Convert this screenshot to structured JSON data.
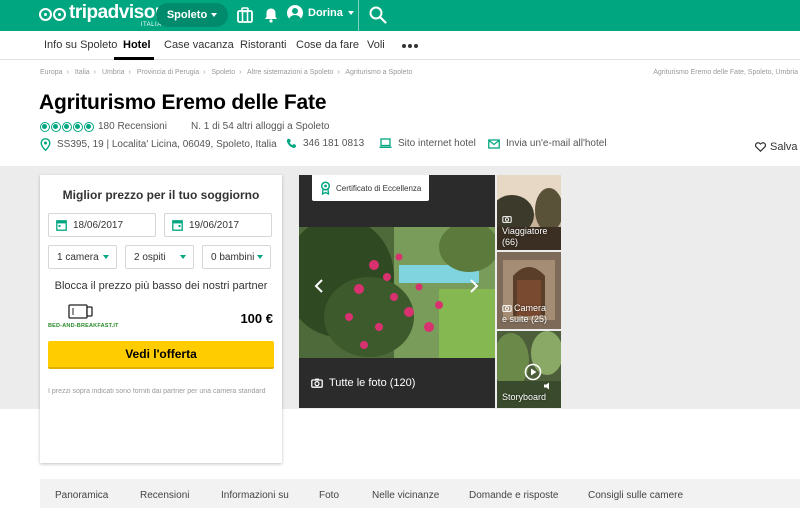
{
  "header": {
    "logo_word": "tripadvisor",
    "logo_sub": "ITALIA",
    "city": "Spoleto",
    "user": "Dorina"
  },
  "nav": {
    "items": [
      {
        "label": "Info su Spoleto"
      },
      {
        "label": "Hotel"
      },
      {
        "label": "Case vacanza"
      },
      {
        "label": "Ristoranti"
      },
      {
        "label": "Cose da fare"
      },
      {
        "label": "Voli"
      }
    ]
  },
  "breadcrumb": {
    "items": [
      "Europa",
      "Italia",
      "Umbria",
      "Provincia di Perugia",
      "Spoleto",
      "Altre sistemazioni a Spoleto",
      "Agriturismo a Spoleto"
    ],
    "right": "Agriturismo Eremo delle Fate, Spoleto, Umbria"
  },
  "hotel": {
    "name": "Agriturismo Eremo delle Fate",
    "rating": 5,
    "reviews": "180 Recensioni",
    "rank": "N. 1 di 54 altri alloggi a Spoleto",
    "address": "SS395, 19 | Localita' Licina, 06049, Spoleto, Italia",
    "phone": "346 181 0813",
    "website": "Sito internet hotel",
    "email": "Invia un'e-mail all'hotel",
    "save": "Salva"
  },
  "booking": {
    "title": "Miglior prezzo per il tuo soggiorno",
    "checkin": "18/06/2017",
    "checkout": "19/06/2017",
    "rooms": "1 camera",
    "guests": "2 ospiti",
    "children": "0 bambini",
    "partner_note": "Blocca il prezzo più basso dei nostri partner",
    "partner_name": "BED-AND-BREAKFAST.IT",
    "price": "100 €",
    "offer_button": "Vedi l'offerta",
    "disclaimer": "I prezzi sopra indicati sono forniti dai partner per una camera standard"
  },
  "photos": {
    "certificate": "Certificato di Eccellenza",
    "all_photos": "Tutte le foto (120)",
    "thumbs": [
      {
        "label": "Viaggiatore",
        "count": "(66)"
      },
      {
        "label": "Camera",
        "count": "e suite (25)"
      },
      {
        "label": "Storyboard"
      }
    ]
  },
  "tabs": {
    "items": [
      {
        "label": "Panoramica"
      },
      {
        "label": "Recensioni"
      },
      {
        "label": "Informazioni su"
      },
      {
        "label": "Foto"
      },
      {
        "label": "Nelle vicinanze"
      },
      {
        "label": "Domande e risposte"
      },
      {
        "label": "Consigli sulle camere"
      }
    ]
  },
  "colors": {
    "brand": "#00a680",
    "offer": "#ffcc00"
  }
}
